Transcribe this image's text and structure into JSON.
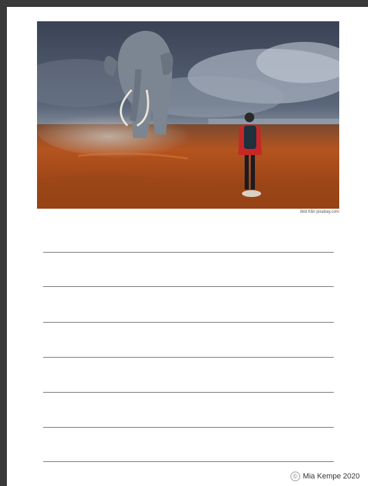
{
  "image": {
    "subject": "elephant-and-hiker-photo",
    "credit": "Bild från pixabay.com"
  },
  "writing_lines": {
    "count": 7
  },
  "footer": {
    "symbol": "©",
    "author": "Mia Kempe 2020"
  },
  "colors": {
    "sky": "#4a566a",
    "cloud": "#a8b3c0",
    "ground": "#b4541f",
    "jacket": "#c62828",
    "line": "#707070"
  }
}
